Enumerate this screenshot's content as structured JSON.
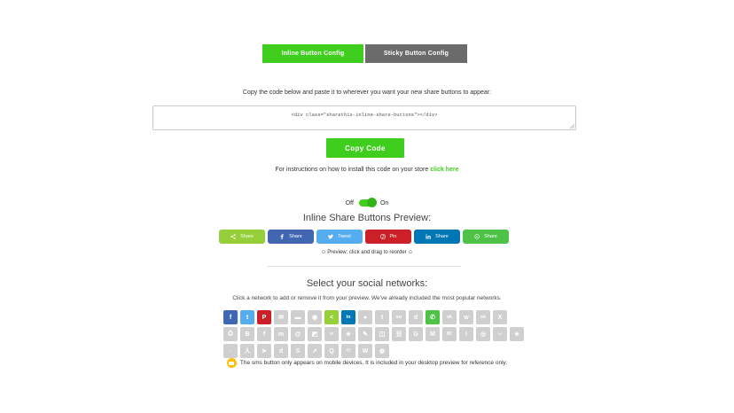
{
  "tabs": {
    "inline": "Inline Button Config",
    "sticky": "Sticky Button Config"
  },
  "instructions": "Copy the code below and paste it to wherever you want your new share buttons to appear:",
  "code_snippet": "<div class=\"sharethis-inline-share-buttons\"></div>",
  "copy_button": "Copy Code",
  "help": {
    "text": "For instructions on how to install this code on your store",
    "link": "click here"
  },
  "toggle": {
    "off": "Off",
    "on": "On",
    "state": "on"
  },
  "preview": {
    "title": "Inline Share Buttons Preview:",
    "buttons": [
      {
        "label": "Share",
        "icon": "share-icon",
        "color": "#95d03a"
      },
      {
        "label": "Share",
        "icon": "facebook-icon",
        "color": "#4267b2"
      },
      {
        "label": "Tweet",
        "icon": "twitter-icon",
        "color": "#55acee"
      },
      {
        "label": "Pin",
        "icon": "pinterest-icon",
        "color": "#cb2027"
      },
      {
        "label": "Share",
        "icon": "linkedin-icon",
        "color": "#0077b5"
      },
      {
        "label": "Share",
        "icon": "whatsapp-icon",
        "color": "#4dc247"
      }
    ],
    "drag_hint": "✩ Preview: click and drag to reorder ✩"
  },
  "networks": {
    "title": "Select your social networks:",
    "subtitle": "Click a network to add or remove it from your preview. We've already included the most popular networks.",
    "row1": [
      {
        "icon": "facebook-icon",
        "glyph": "f",
        "color": "#4267b2"
      },
      {
        "icon": "twitter-icon",
        "glyph": "t",
        "color": "#55acee"
      },
      {
        "icon": "pinterest-icon",
        "glyph": "P",
        "color": "#cb2027"
      },
      {
        "icon": "email-icon",
        "glyph": "✉",
        "color": "#cfcfcf"
      },
      {
        "icon": "sms-icon",
        "glyph": "▬",
        "color": "#cfcfcf"
      },
      {
        "icon": "messenger-icon",
        "glyph": "◉",
        "color": "#cfcfcf"
      },
      {
        "icon": "sharethis-icon",
        "glyph": "<",
        "color": "#95d03a"
      },
      {
        "icon": "linkedin-icon",
        "glyph": "in",
        "color": "#0077b5"
      },
      {
        "icon": "reddit-icon",
        "glyph": "●",
        "color": "#cfcfcf"
      },
      {
        "icon": "tumblr-icon",
        "glyph": "t",
        "color": "#cfcfcf"
      },
      {
        "icon": "stumbleupon-icon",
        "glyph": "su",
        "color": "#cfcfcf"
      },
      {
        "icon": "digg-icon",
        "glyph": "d",
        "color": "#cfcfcf"
      },
      {
        "icon": "whatsapp-icon",
        "glyph": "✆",
        "color": "#4dc247"
      },
      {
        "icon": "vk-icon",
        "glyph": "vk",
        "color": "#cfcfcf"
      },
      {
        "icon": "weibo-icon",
        "glyph": "w",
        "color": "#cfcfcf"
      },
      {
        "icon": "odnoklassniki-icon",
        "glyph": "ok",
        "color": "#cfcfcf"
      },
      {
        "icon": "xing-icon",
        "glyph": "X",
        "color": "#cfcfcf"
      }
    ],
    "row2": [
      {
        "icon": "print-icon",
        "glyph": "⎙",
        "color": "#cfcfcf"
      },
      {
        "icon": "blogger-icon",
        "glyph": "B",
        "color": "#cfcfcf"
      },
      {
        "icon": "flipboard-icon",
        "glyph": "f",
        "color": "#cfcfcf"
      },
      {
        "icon": "meneame-icon",
        "glyph": "m",
        "color": "#cfcfcf"
      },
      {
        "icon": "mailru-icon",
        "glyph": "@",
        "color": "#cfcfcf"
      },
      {
        "icon": "delicious-icon",
        "glyph": "◩",
        "color": "#cfcfcf"
      },
      {
        "icon": "buffer-icon",
        "glyph": "≡",
        "color": "#cfcfcf"
      },
      {
        "icon": "bookmark-star-icon",
        "glyph": "★",
        "color": "#cfcfcf"
      },
      {
        "icon": "livejournal-icon",
        "glyph": "✎",
        "color": "#cfcfcf"
      },
      {
        "icon": "google-bookmarks-icon",
        "glyph": "◫",
        "color": "#cfcfcf"
      },
      {
        "icon": "douban-icon",
        "glyph": "豆",
        "color": "#cfcfcf"
      },
      {
        "icon": "google-icon",
        "glyph": "G",
        "color": "#cfcfcf"
      },
      {
        "icon": "gmail-icon",
        "glyph": "M",
        "color": "#cfcfcf"
      },
      {
        "icon": "hatena-icon",
        "glyph": "B!",
        "color": "#cfcfcf"
      },
      {
        "icon": "instapaper-icon",
        "glyph": "I",
        "color": "#cfcfcf"
      },
      {
        "icon": "line-icon",
        "glyph": "◎",
        "color": "#cfcfcf"
      },
      {
        "icon": "pocket-icon",
        "glyph": "⌵",
        "color": "#cfcfcf"
      },
      {
        "icon": "qzone-icon",
        "glyph": "★",
        "color": "#cfcfcf"
      }
    ],
    "row3": [
      {
        "icon": "refind-icon",
        "glyph": "◌",
        "color": "#cfcfcf"
      },
      {
        "icon": "renren-icon",
        "glyph": "人",
        "color": "#cfcfcf"
      },
      {
        "icon": "surfingbird-icon",
        "glyph": "➤",
        "color": "#cfcfcf"
      },
      {
        "icon": "diigo-icon",
        "glyph": "d",
        "color": "#cfcfcf"
      },
      {
        "icon": "skype-icon",
        "glyph": "S",
        "color": "#cfcfcf"
      },
      {
        "icon": "telegram-icon",
        "glyph": "➚",
        "color": "#cfcfcf"
      },
      {
        "icon": "tencent-qq-icon",
        "glyph": "Q",
        "color": "#cfcfcf"
      },
      {
        "icon": "yahoo-icon",
        "glyph": "Y!",
        "color": "#cfcfcf"
      },
      {
        "icon": "wordpress-icon",
        "glyph": "W",
        "color": "#cfcfcf"
      },
      {
        "icon": "wechat-icon",
        "glyph": "◍",
        "color": "#cfcfcf"
      }
    ]
  },
  "sms_note": "The sms button only appears on mobile devices. It is included in your desktop preview for reference only."
}
